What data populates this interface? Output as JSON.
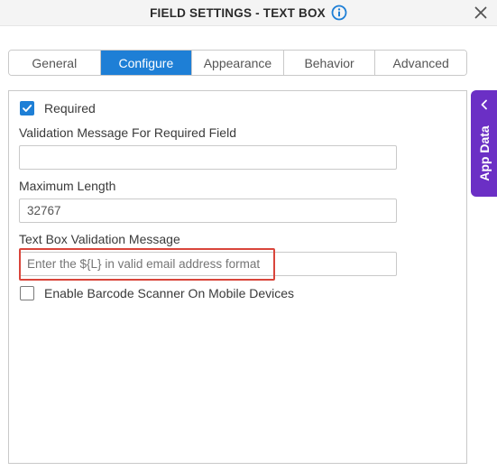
{
  "dialog": {
    "title": "FIELD SETTINGS - TEXT BOX",
    "info_icon": "info-circle-icon",
    "close_icon": "close-icon"
  },
  "tabs": [
    {
      "label": "General",
      "active": false
    },
    {
      "label": "Configure",
      "active": true
    },
    {
      "label": "Appearance",
      "active": false
    },
    {
      "label": "Behavior",
      "active": false
    },
    {
      "label": "Advanced",
      "active": false
    }
  ],
  "configure": {
    "required": {
      "label": "Required",
      "checked": true
    },
    "required_message": {
      "label": "Validation Message For Required Field",
      "value": ""
    },
    "max_length": {
      "label": "Maximum Length",
      "value": "32767"
    },
    "validation_message": {
      "label": "Text Box Validation Message",
      "placeholder": "Enter the ${L} in valid email address format"
    },
    "barcode_scanner": {
      "label": "Enable Barcode Scanner On Mobile Devices",
      "checked": false
    }
  },
  "side_panel": {
    "label": "App Data",
    "chevron_icon": "chevron-left-icon"
  },
  "colors": {
    "accent": "#1e7fd6",
    "side_panel": "#6b2fc5",
    "highlight": "#d9453b"
  }
}
